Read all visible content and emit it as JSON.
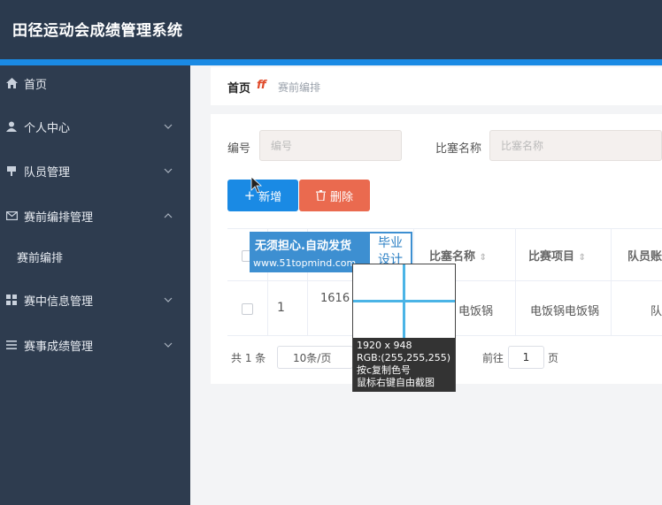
{
  "app": {
    "title": "田径运动会成绩管理系统"
  },
  "sidebar": {
    "items": [
      {
        "label": "首页",
        "icon": "home-icon"
      },
      {
        "label": "个人中心",
        "icon": "user-icon"
      },
      {
        "label": "队员管理",
        "icon": "flag-icon"
      },
      {
        "label": "赛前编排管理",
        "icon": "mail-icon"
      },
      {
        "label": "赛前编排"
      },
      {
        "label": "赛中信息管理",
        "icon": "grid-icon"
      },
      {
        "label": "赛事成绩管理",
        "icon": "menu-icon"
      }
    ]
  },
  "breadcrumb": {
    "home": "首页",
    "separator": "ff",
    "current": "赛前编排"
  },
  "search": {
    "id_label": "编号",
    "id_placeholder": "编号",
    "name_label": "比塞名称",
    "name_placeholder": "比塞名称"
  },
  "toolbar": {
    "add_label": "新增",
    "delete_label": "删除"
  },
  "table": {
    "columns": [
      "比塞名称",
      "比赛项目",
      "队员账"
    ],
    "rows": [
      {
        "index": "1",
        "id": "1616",
        "name": "电饭锅",
        "event": "电饭锅电饭锅",
        "member": "队"
      }
    ]
  },
  "pagination": {
    "total": "共 1 条",
    "size": "10条/页",
    "goto": "前往",
    "page": "1",
    "page_suffix": "页"
  },
  "ad": {
    "line1": "无须担心.自动发货",
    "line2": "www.51topmind.com",
    "badge1": "毕业",
    "badge2": "设计"
  },
  "picker": {
    "size": "1920 x 948",
    "rgb": "RGB:(255,255,255)",
    "hint1": "按c复制色号",
    "hint2": "鼠标右键自由截图"
  },
  "colors": {
    "primary": "#1a8ae4",
    "danger": "#ea6a4f",
    "sidebar": "#2e3c4f",
    "topbar": "#2b3a4e"
  }
}
